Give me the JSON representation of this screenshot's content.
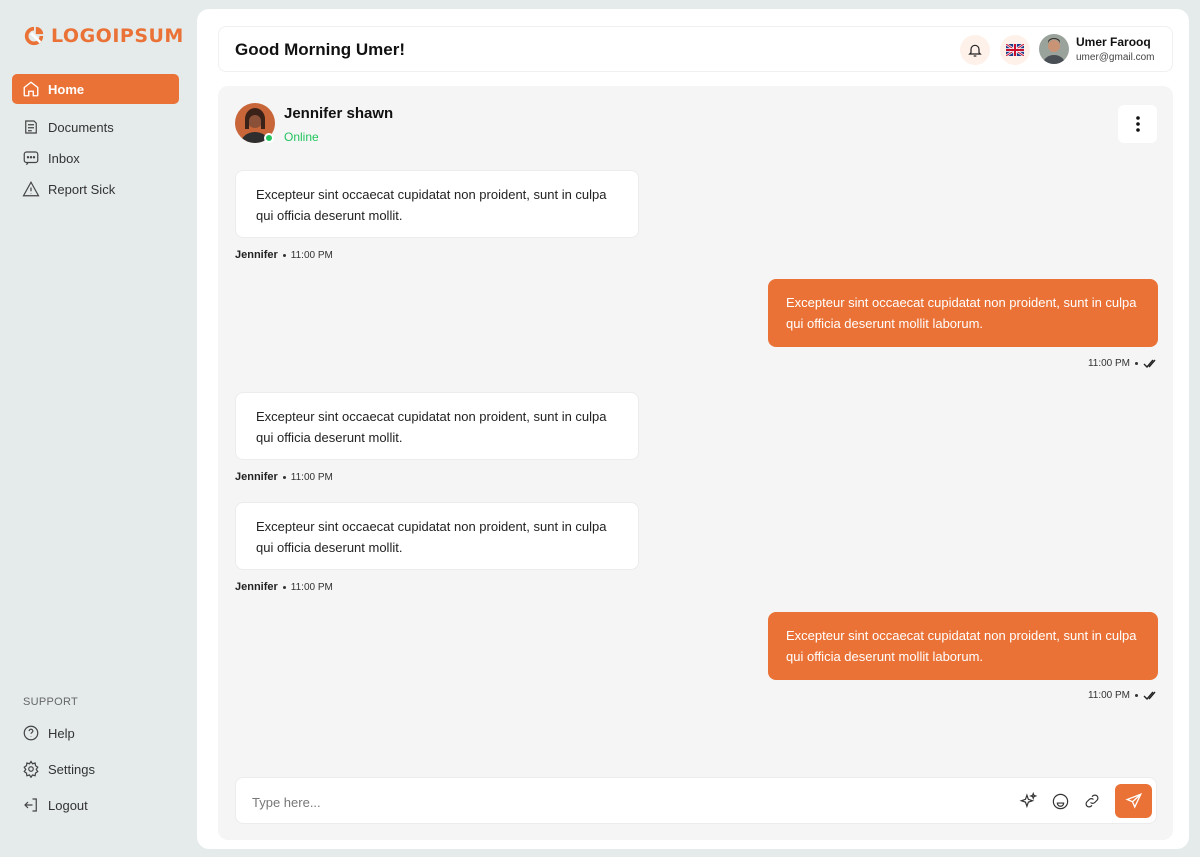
{
  "brand": {
    "name": "LOGOIPSUM",
    "accent": "#ea7236"
  },
  "sidebar": {
    "items": [
      {
        "label": "Home",
        "icon": "home-icon",
        "active": true
      },
      {
        "label": "Documents",
        "icon": "documents-icon",
        "active": false
      },
      {
        "label": "Inbox",
        "icon": "inbox-icon",
        "active": false
      },
      {
        "label": "Report Sick",
        "icon": "warning-icon",
        "active": false
      }
    ],
    "support_heading": "SUPPORT",
    "support_items": [
      {
        "label": "Help",
        "icon": "help-icon"
      },
      {
        "label": "Settings",
        "icon": "gear-icon"
      },
      {
        "label": "Logout",
        "icon": "logout-icon"
      }
    ]
  },
  "header": {
    "greeting": "Good Morning Umer!",
    "user": {
      "name": "Umer Farooq",
      "email": "umer@gmail.com"
    }
  },
  "chat": {
    "contact": {
      "name": "Jennifer shawn",
      "status": "Online"
    },
    "messages": [
      {
        "direction": "in",
        "text": "Excepteur sint occaecat cupidatat non proident, sunt in culpa qui officia deserunt mollit.",
        "sender": "Jennifer",
        "time": "11:00 PM"
      },
      {
        "direction": "out",
        "text": "Excepteur sint occaecat cupidatat non proident, sunt in culpa qui officia deserunt mollit laborum.",
        "time": "11:00 PM"
      },
      {
        "direction": "in",
        "text": "Excepteur sint occaecat cupidatat non proident, sunt in culpa qui officia deserunt mollit.",
        "sender": "Jennifer",
        "time": "11:00 PM"
      },
      {
        "direction": "in",
        "text": "Excepteur sint occaecat cupidatat non proident, sunt in culpa qui officia deserunt mollit.",
        "sender": "Jennifer",
        "time": "11:00 PM"
      },
      {
        "direction": "out",
        "text": "Excepteur sint occaecat cupidatat non proident, sunt in culpa qui officia deserunt mollit laborum.",
        "time": "11:00 PM"
      }
    ],
    "composer": {
      "placeholder": "Type here..."
    }
  }
}
